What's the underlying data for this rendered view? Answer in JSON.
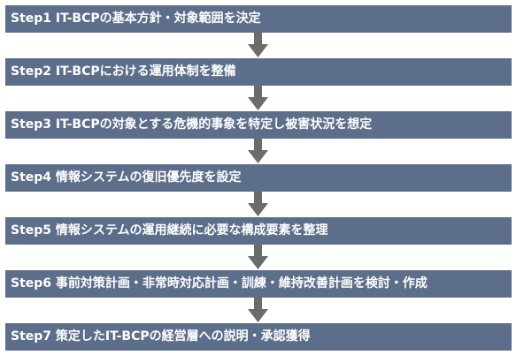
{
  "steps": [
    {
      "label": "Step1  IT-BCPの基本方針・対象範囲を決定"
    },
    {
      "label": "Step2  IT-BCPにおける運用体制を整備"
    },
    {
      "label": "Step3  IT-BCPの対象とする危機的事象を特定し被害状況を想定"
    },
    {
      "label": "Step4  情報システムの復旧優先度を設定"
    },
    {
      "label": "Step5  情報システムの運用継続に必要な構成要素を整理"
    },
    {
      "label": "Step6  事前対策計画・非常時対応計画・訓練・維持改善計画を検討・作成"
    },
    {
      "label": "Step7  策定したIT-BCPの経営層への説明・承認獲得"
    }
  ],
  "colors": {
    "box": "#5d6e8a",
    "text": "#ffffff",
    "arrow": "#6b6b6b"
  }
}
